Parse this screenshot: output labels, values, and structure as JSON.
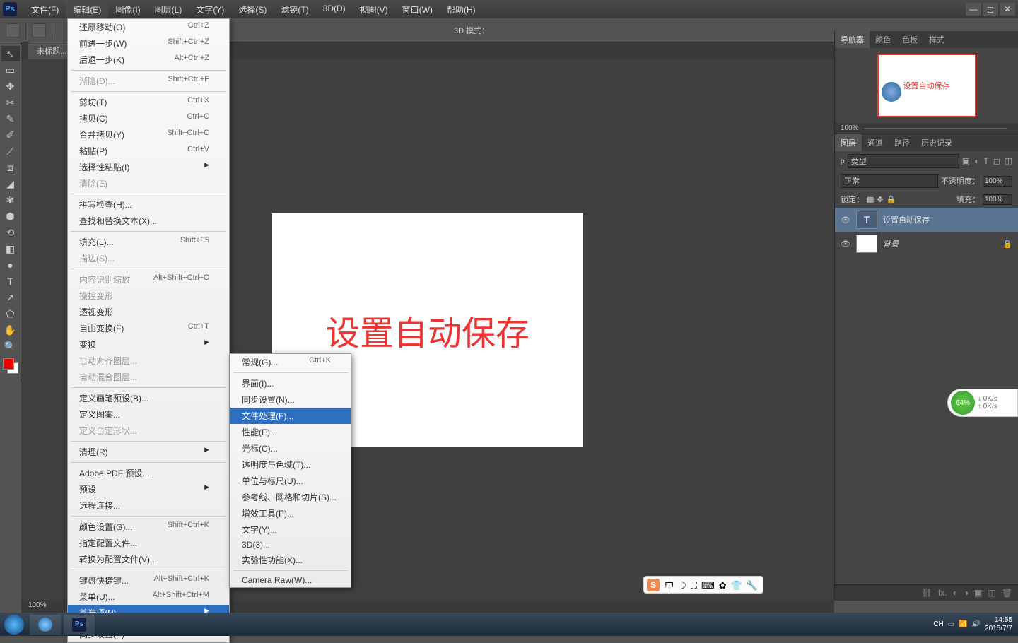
{
  "app": {
    "logo": "Ps"
  },
  "menubar": [
    "文件(F)",
    "编辑(E)",
    "图像(I)",
    "图层(L)",
    "文字(Y)",
    "选择(S)",
    "滤镜(T)",
    "3D(D)",
    "视图(V)",
    "窗口(W)",
    "帮助(H)"
  ],
  "menubar_open_index": 1,
  "options": {
    "mode_label": "3D 模式："
  },
  "doc": {
    "tab": "未标题...",
    "text": "设置自动保存",
    "zoom_status": "100%"
  },
  "edit_menu": {
    "groups": [
      [
        {
          "l": "还原移动(O)",
          "s": "Ctrl+Z"
        },
        {
          "l": "前进一步(W)",
          "s": "Shift+Ctrl+Z"
        },
        {
          "l": "后退一步(K)",
          "s": "Alt+Ctrl+Z"
        }
      ],
      [
        {
          "l": "渐隐(D)...",
          "s": "Shift+Ctrl+F",
          "d": true
        }
      ],
      [
        {
          "l": "剪切(T)",
          "s": "Ctrl+X"
        },
        {
          "l": "拷贝(C)",
          "s": "Ctrl+C"
        },
        {
          "l": "合并拷贝(Y)",
          "s": "Shift+Ctrl+C"
        },
        {
          "l": "粘贴(P)",
          "s": "Ctrl+V"
        },
        {
          "l": "选择性粘贴(I)",
          "arrow": true
        },
        {
          "l": "清除(E)",
          "d": true
        }
      ],
      [
        {
          "l": "拼写检查(H)..."
        },
        {
          "l": "查找和替换文本(X)..."
        }
      ],
      [
        {
          "l": "填充(L)...",
          "s": "Shift+F5"
        },
        {
          "l": "描边(S)...",
          "d": true
        }
      ],
      [
        {
          "l": "内容识别缩放",
          "s": "Alt+Shift+Ctrl+C",
          "d": true
        },
        {
          "l": "操控变形",
          "d": true
        },
        {
          "l": "透视变形"
        },
        {
          "l": "自由变换(F)",
          "s": "Ctrl+T"
        },
        {
          "l": "变换",
          "arrow": true
        },
        {
          "l": "自动对齐图层...",
          "d": true
        },
        {
          "l": "自动混合图层...",
          "d": true
        }
      ],
      [
        {
          "l": "定义画笔预设(B)..."
        },
        {
          "l": "定义图案..."
        },
        {
          "l": "定义自定形状...",
          "d": true
        }
      ],
      [
        {
          "l": "清理(R)",
          "arrow": true
        }
      ],
      [
        {
          "l": "Adobe PDF 预设..."
        },
        {
          "l": "预设",
          "arrow": true
        },
        {
          "l": "远程连接..."
        }
      ],
      [
        {
          "l": "颜色设置(G)...",
          "s": "Shift+Ctrl+K"
        },
        {
          "l": "指定配置文件..."
        },
        {
          "l": "转换为配置文件(V)..."
        }
      ],
      [
        {
          "l": "键盘快捷键...",
          "s": "Alt+Shift+Ctrl+K"
        },
        {
          "l": "菜单(U)...",
          "s": "Alt+Shift+Ctrl+M"
        },
        {
          "l": "首选项(N)",
          "arrow": true,
          "hl": true
        }
      ],
      [
        {
          "l": "同步设置(E)",
          "arrow": true
        }
      ]
    ]
  },
  "prefs_submenu": [
    {
      "l": "常规(G)...",
      "s": "Ctrl+K"
    },
    "-",
    {
      "l": "界面(I)..."
    },
    {
      "l": "同步设置(N)..."
    },
    {
      "l": "文件处理(F)...",
      "hl": true
    },
    {
      "l": "性能(E)..."
    },
    {
      "l": "光标(C)..."
    },
    {
      "l": "透明度与色域(T)..."
    },
    {
      "l": "单位与标尺(U)..."
    },
    {
      "l": "参考线、网格和切片(S)..."
    },
    {
      "l": "增效工具(P)..."
    },
    {
      "l": "文字(Y)..."
    },
    {
      "l": "3D(3)..."
    },
    {
      "l": "实验性功能(X)..."
    },
    "-",
    {
      "l": "Camera Raw(W)..."
    }
  ],
  "panels": {
    "nav_tabs": [
      "导航器",
      "颜色",
      "色板",
      "样式"
    ],
    "nav_zoom": "100%",
    "layer_tabs": [
      "图层",
      "通道",
      "路径",
      "历史记录"
    ],
    "kind_label": "类型",
    "blend": "正常",
    "opacity_label": "不透明度：",
    "opacity": "100%",
    "lock_label": "锁定：",
    "fill_label": "填充：",
    "fill": "100%",
    "layers": [
      {
        "name": "设置自动保存",
        "type": "T",
        "sel": true
      },
      {
        "name": "背景",
        "type": "bg",
        "locked": true
      }
    ]
  },
  "tools": [
    "↖",
    "▭",
    "✥",
    "✂",
    "✎",
    "✐",
    "⟋",
    "⧈",
    "◢",
    "✾",
    "⬢",
    "⟲",
    "◧",
    "●",
    "T",
    "↗",
    "⬠",
    "✋",
    "🔍"
  ],
  "ime": {
    "items": [
      "中",
      "☽",
      "⛶",
      "⌨",
      "✿",
      "👕",
      "🔧"
    ]
  },
  "net": {
    "pct": "64%",
    "down": "0K/s",
    "up": "0K/s"
  },
  "tray": {
    "lang": "CH",
    "time": "14:55",
    "date": "2015/7/7"
  }
}
